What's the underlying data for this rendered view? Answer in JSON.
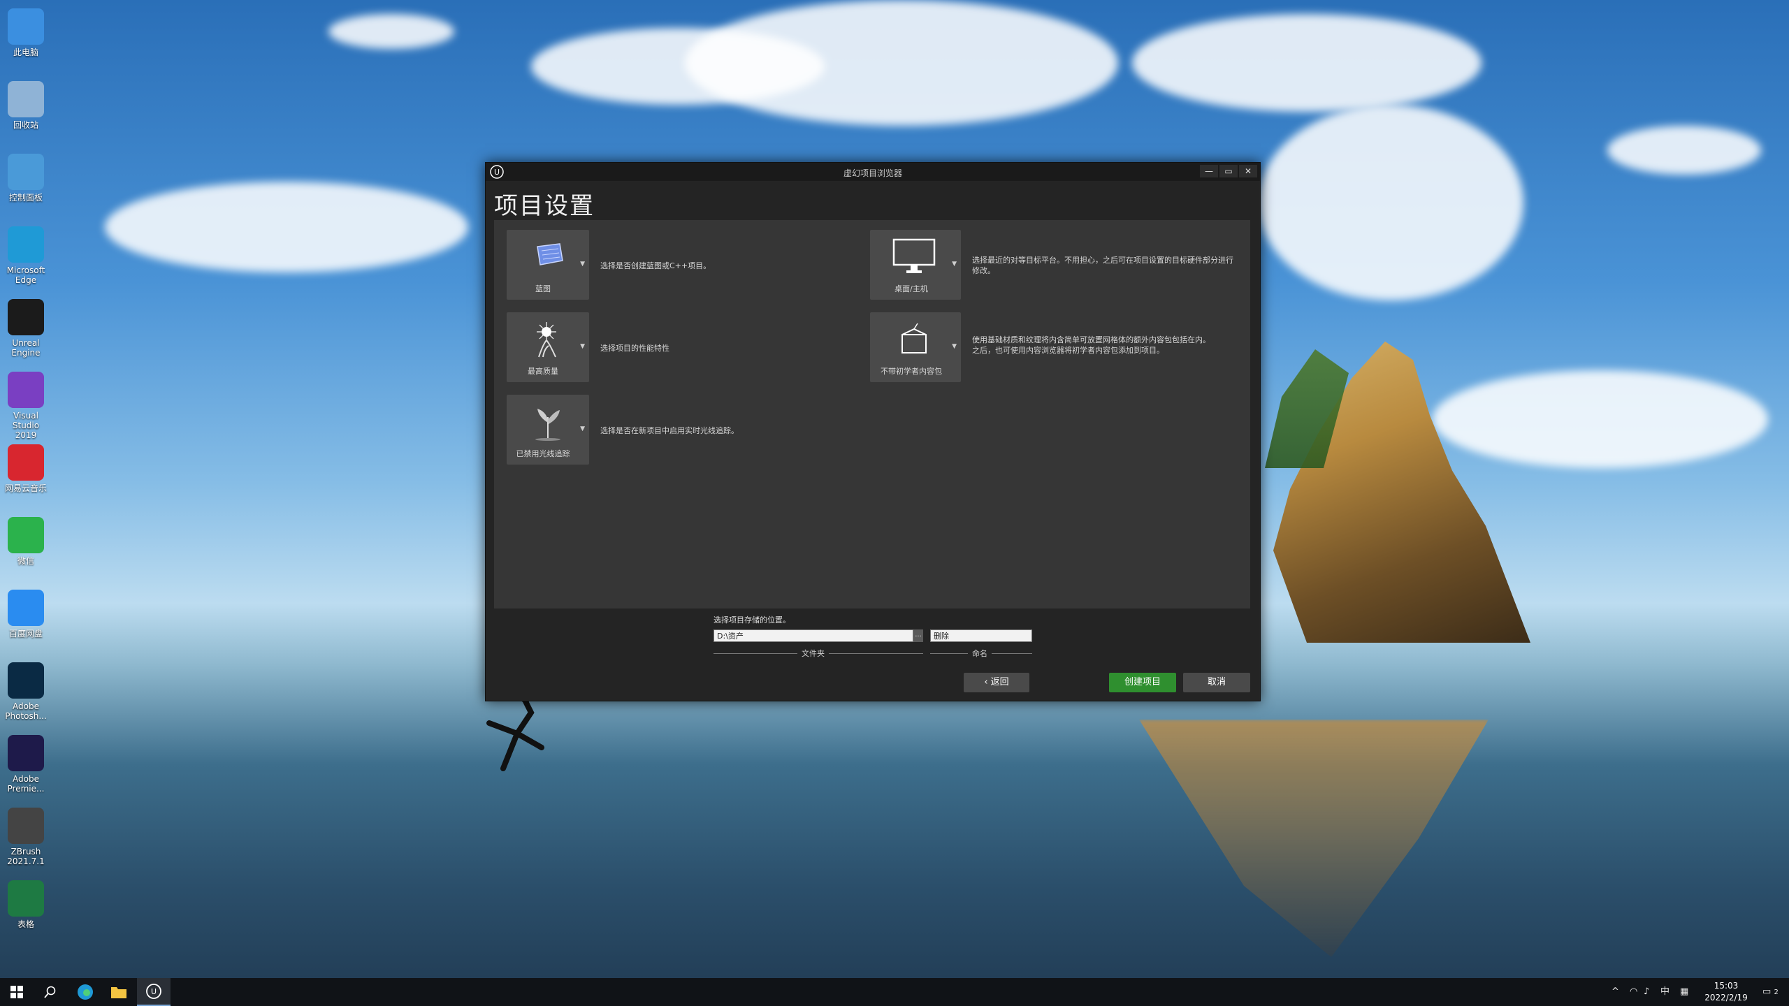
{
  "desktop": {
    "icons": [
      {
        "label": "此电脑",
        "icon": "computer-icon",
        "color": "#3b8fe0"
      },
      {
        "label": "回收站",
        "icon": "recycle-bin-icon",
        "color": "#8fb3d6"
      },
      {
        "label": "控制面板",
        "icon": "control-panel-icon",
        "color": "#4a9ad8"
      },
      {
        "label": "Microsoft Edge",
        "icon": "edge-icon",
        "color": "#1f9ad6"
      },
      {
        "label": "Unreal Engine",
        "icon": "unreal-engine-icon",
        "color": "#1b1b1b"
      },
      {
        "label": "Visual Studio 2019",
        "icon": "visual-studio-icon",
        "color": "#7a3fc2"
      },
      {
        "label": "网易云音乐",
        "icon": "netease-music-icon",
        "color": "#d8262f"
      },
      {
        "label": "微信",
        "icon": "wechat-icon",
        "color": "#2bb24c"
      },
      {
        "label": "百度网盘",
        "icon": "baidu-netdisk-icon",
        "color": "#2a8cf0"
      },
      {
        "label": "Adobe Photosh...",
        "icon": "photoshop-icon",
        "color": "#0a2a44"
      },
      {
        "label": "Adobe Premie...",
        "icon": "premiere-icon",
        "color": "#1e1a4a"
      },
      {
        "label": "ZBrush 2021.7.1",
        "icon": "zbrush-icon",
        "color": "#444444"
      },
      {
        "label": "表格",
        "icon": "excel-icon",
        "color": "#1e7a43"
      }
    ]
  },
  "window": {
    "title": "虚幻项目浏览器",
    "heading": "项目设置",
    "controls": {
      "minimize": "—",
      "maximize": "▭",
      "close": "✕"
    },
    "options": [
      {
        "id": "blueprint",
        "caption": "蓝图",
        "desc": "选择是否创建蓝图或C++项目。"
      },
      {
        "id": "quality",
        "caption": "最高质量",
        "desc": "选择项目的性能特性"
      },
      {
        "id": "raytracing",
        "caption": "已禁用光线追踪",
        "desc": "选择是否在新项目中启用实时光线追踪。"
      },
      {
        "id": "platform",
        "caption": "桌面/主机",
        "desc": "选择最近的对等目标平台。不用担心，之后可在项目设置的目标硬件部分进行修改。"
      },
      {
        "id": "starter",
        "caption": "不带初学者内容包",
        "desc_line1": "使用基础材质和纹理将内含简单可放置网格体的额外内容包包括在内。",
        "desc_line2": "之后，也可使用内容浏览器将初学者内容包添加到项目。"
      }
    ],
    "location": {
      "label": "选择项目存储的位置。",
      "folder_value": "D:\\资产",
      "browse": "...",
      "name_value": "删除",
      "folder_label": "文件夹",
      "name_label": "命名"
    },
    "buttons": {
      "back": "‹ 返回",
      "create": "创建项目",
      "cancel": "取消"
    },
    "colors": {
      "create_button": "#2f8f2f",
      "panel": "#363636"
    }
  },
  "taskbar": {
    "tray": {
      "ime": "中",
      "time": "15:03",
      "date": "2022/2/19",
      "notifications": "2"
    }
  }
}
